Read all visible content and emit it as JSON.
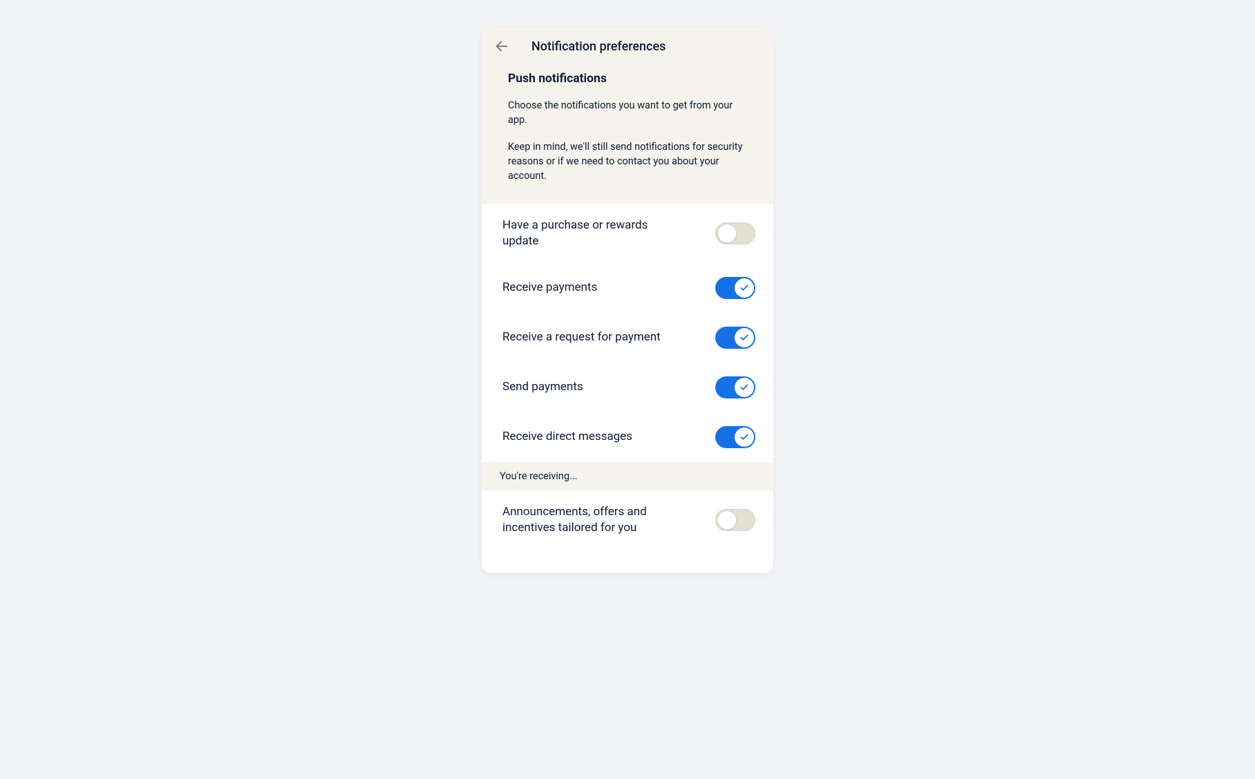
{
  "header": {
    "title": "Notification preferences",
    "section_title": "Push notifications",
    "intro1": "Choose the notifications you want to get from your app.",
    "intro2": "Keep in mind, we'll still send notifications for security reasons or if we need to contact you about your account."
  },
  "toggles": [
    {
      "label": "Have a purchase or rewards update",
      "on": false
    },
    {
      "label": "Receive payments",
      "on": true
    },
    {
      "label": "Receive a request for payment",
      "on": true
    },
    {
      "label": "Send payments",
      "on": true
    },
    {
      "label": "Receive direct messages",
      "on": true
    }
  ],
  "subheader": "You're receiving...",
  "toggles2": [
    {
      "label": "Announcements, offers and incentives tailored for you",
      "on": false
    }
  ]
}
